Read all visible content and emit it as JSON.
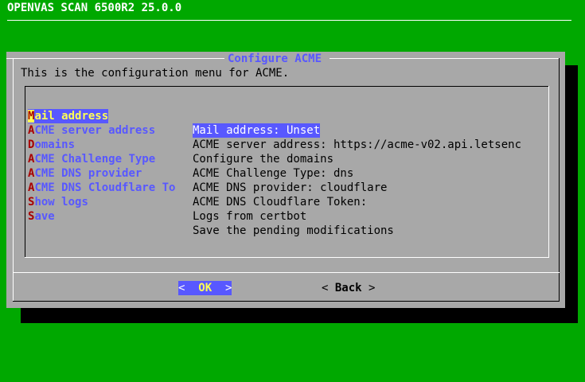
{
  "backtitle": "OPENVAS SCAN 6500R2 25.0.0",
  "dialog": {
    "title": "Configure ACME",
    "prompt": "This is the configuration menu for ACME."
  },
  "menu": {
    "items": [
      {
        "hotkey": "M",
        "tag_rest": "ail address",
        "item": "Mail address: Unset",
        "selected": true
      },
      {
        "hotkey": "A",
        "tag_rest": "CME server address",
        "item": "ACME server address: https://acme-v02.api.letsenc"
      },
      {
        "hotkey": "D",
        "tag_rest": "omains",
        "item": "Configure the domains"
      },
      {
        "hotkey": "A",
        "tag_rest": "CME Challenge Type",
        "item": "ACME Challenge Type: dns"
      },
      {
        "hotkey": "A",
        "tag_rest": "CME DNS provider",
        "item": "ACME DNS provider: cloudflare"
      },
      {
        "hotkey": "A",
        "tag_rest": "CME DNS Cloudflare To",
        "item": "ACME DNS Cloudflare Token:"
      },
      {
        "hotkey": "S",
        "tag_rest": "how logs",
        "item": "Logs from certbot"
      },
      {
        "hotkey": "S",
        "tag_rest": "ave",
        "item": "Save the pending modifications"
      }
    ]
  },
  "buttons": {
    "ok_left": "<",
    "ok_label": "OK",
    "ok_right": ">",
    "back_left": "<",
    "back_label": "Back",
    "back_right": ">"
  },
  "colors": {
    "background": "#00a800",
    "dialog": "#a8a8a8",
    "accent": "#5858ff",
    "highlight": "#ffff54",
    "hotkey": "#a80000"
  }
}
